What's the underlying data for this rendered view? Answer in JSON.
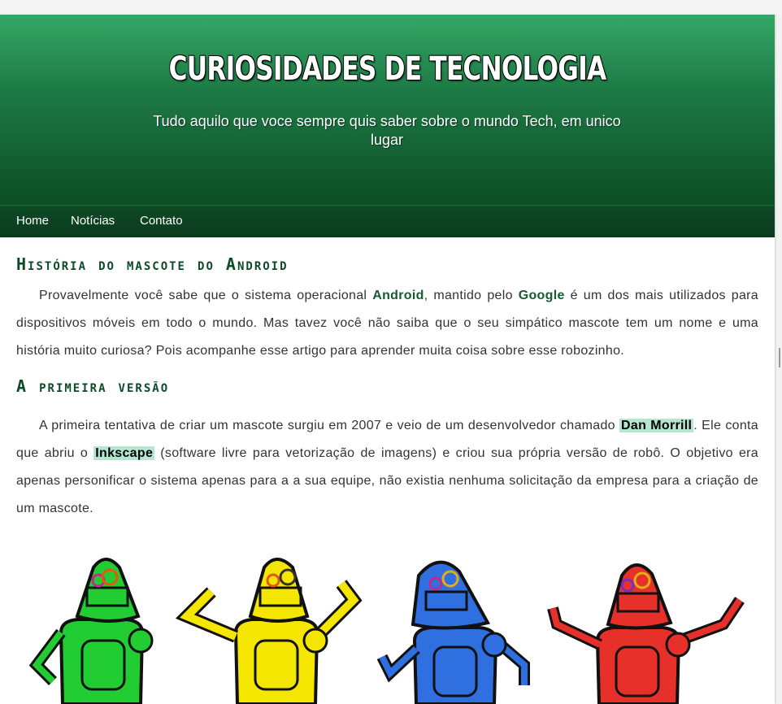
{
  "header": {
    "title": "CURIOSIDADES DE TECNOLOGIA",
    "tagline": "Tudo aquilo que voce sempre quis saber sobre o mundo Tech, em unico lugar"
  },
  "nav": {
    "items": [
      {
        "label": "Home"
      },
      {
        "label": "Notícias"
      },
      {
        "label": "Contato"
      }
    ]
  },
  "article": {
    "title": "História do mascote do Android",
    "p1": {
      "t1": "Provavelmente você sabe que o sistema operacional ",
      "b1": "Android",
      "t2": ", mantido pelo ",
      "b2": "Google",
      "t3": " é um dos mais utilizados para dispositivos móveis em todo o mundo. Mas tavez você não saiba que o seu simpático mascote tem um nome e uma história muito curiosa? Pois acompanhe esse artigo para aprender muita coisa sobre esse robozinho."
    },
    "section_title": "A primeira versão",
    "p2": {
      "t1": "A primeira tentativa de criar um mascote surgiu em 2007 e veio de um desenvolvedor chamado ",
      "h1": "Dan Morrill",
      "t2": ". Ele conta que abriu o ",
      "h2": "Inkscape",
      "t3": " (software livre para vetorização de imagens) e criou sua própria versão de robô. O objetivo era apenas personificar o sistema apenas para a a sua equipe, não existia nenhuma solicitação da empresa para a criação de um mascote."
    }
  },
  "robots": [
    {
      "color": "#22cc33"
    },
    {
      "color": "#f5e600"
    },
    {
      "color": "#2f6fe0"
    },
    {
      "color": "#e8302a"
    }
  ]
}
